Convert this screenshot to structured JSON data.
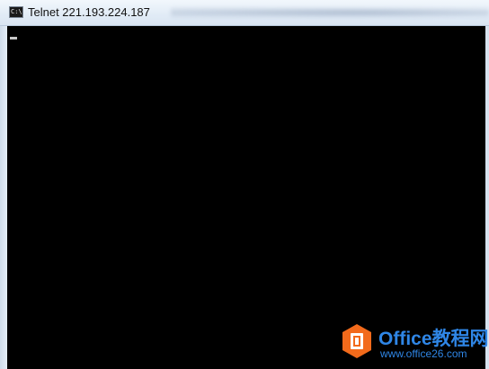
{
  "window": {
    "title": "Telnet 221.193.224.187",
    "icon": "command-prompt-icon",
    "icon_glyph": "C:\\"
  },
  "console": {
    "background": "#000000",
    "cursor_color": "#c8c8c8"
  },
  "watermark": {
    "brand": "Office教程网",
    "url": "www.office26.com",
    "accent": "#2f86e6",
    "logo_color": "#f26a1b"
  }
}
